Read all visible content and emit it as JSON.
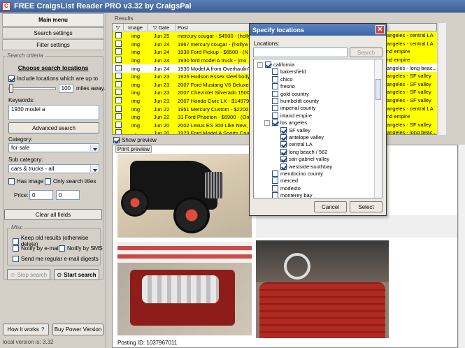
{
  "window": {
    "title": "FREE CraigsList Reader PRO v3.32 by CraigsPal"
  },
  "sidebar": {
    "main_menu": "Main menu",
    "search_settings": "Search settings",
    "filter_settings": "Filter settings",
    "search_criteria_label": "Search criteria",
    "choose_locations": "Choose search locations",
    "include_locations_label": "Include locations which are up to",
    "distance_value": "100",
    "miles_away": "miles away.",
    "keywords_label": "Keywords:",
    "keywords_value": "1930 model a",
    "advanced_search": "Advanced search",
    "category_label": "Category:",
    "category_value": "for sale",
    "subcategory_label": "Sub category:",
    "subcategory_value": "cars & trucks - all",
    "has_image": "Has image",
    "only_search_titles": "Only search titles",
    "price_label": "Price:",
    "price_min": "0",
    "price_max": "0",
    "clear_all_fields": "Clear all fields",
    "misc_label": "Misc",
    "keep_old_results": "Keep old results (otherwise delete)",
    "notify_email": "Notify by e-mail",
    "notify_sms": "Notify by SMS",
    "send_digests": "Send me regular e-mail digests",
    "stop_search": "Stop search",
    "start_search": "Start search",
    "how_it_works": "How it works",
    "buy_power": "Buy Power Version",
    "local_version": "local version is: 3.32"
  },
  "results": {
    "label": "Results",
    "columns": [
      "",
      "Image",
      "Date",
      "Post"
    ],
    "rows": [
      {
        "image": "img",
        "date": "Jun 25",
        "post": "mercury cougar - $4500 - (holly",
        "location": "angeles - central LA",
        "highlight": true
      },
      {
        "image": "img",
        "date": "Jun 24",
        "post": "1967 mercury cougar - (hollyw",
        "location": "angeles - central LA",
        "highlight": true
      },
      {
        "image": "img",
        "date": "Jun 24",
        "post": "1930 Ford Pickup - $6500 - (N",
        "location": "nd empire",
        "highlight": true
      },
      {
        "image": "img",
        "date": "Jun 24",
        "post": "1930 ford model A truck - (mo",
        "location": "nd empire",
        "highlight": true
      },
      {
        "image": "img",
        "date": "Jun 24",
        "post": "1930 Model A from Overhaulin'",
        "location": "angeles - long beac...",
        "highlight": false
      },
      {
        "image": "img",
        "date": "Jun 23",
        "post": "1926 Hudson Essex steel body",
        "location": "angeles - SF valley",
        "highlight": true
      },
      {
        "image": "img",
        "date": "Jun 23",
        "post": "2007 Ford Mustang V6 Deluxe",
        "location": "angeles - SF valley",
        "highlight": true
      },
      {
        "image": "img",
        "date": "Jun 23",
        "post": "2007 Chevrolet Silverado 1500",
        "location": "angeles - SF valley",
        "highlight": true
      },
      {
        "image": "img",
        "date": "Jun 23",
        "post": "2007 Honda Civic LX - $14979",
        "location": "angeles - SF valley",
        "highlight": true
      },
      {
        "image": "img",
        "date": "Jun 22",
        "post": "1951 Mercury Custom - $2200",
        "location": "angeles - central LA",
        "highlight": true
      },
      {
        "image": "img",
        "date": "Jun 22",
        "post": "31 Ford Phaeton - $6900 - (Ont",
        "location": "nd empire",
        "highlight": true
      },
      {
        "image": "img",
        "date": "Jun 20",
        "post": "2002 Lexus ES 300 Like New,",
        "location": "angeles - SF valley",
        "highlight": true
      },
      {
        "image": "-",
        "date": "Jun 20",
        "post": "1929 Ford Model A Sports Cou",
        "location": "angeles - long beac...",
        "highlight": true
      }
    ]
  },
  "preview": {
    "show_preview": "Show preview",
    "print_preview": "Print preview",
    "posting_id_text": "Posting ID: 1037967011"
  },
  "dialog": {
    "title": "Specify locations",
    "locations_label": "Locations:",
    "search_placeholder": "",
    "search_button": "Search",
    "tree": [
      {
        "label": "california",
        "level": 0,
        "checked": true,
        "expander": "-"
      },
      {
        "label": "bakersfield",
        "level": 1,
        "checked": false
      },
      {
        "label": "chico",
        "level": 1,
        "checked": false
      },
      {
        "label": "fresno",
        "level": 1,
        "checked": false
      },
      {
        "label": "gold country",
        "level": 1,
        "checked": false
      },
      {
        "label": "humboldt county",
        "level": 1,
        "checked": false
      },
      {
        "label": "imperial county",
        "level": 1,
        "checked": false
      },
      {
        "label": "inland empire",
        "level": 1,
        "checked": false
      },
      {
        "label": "los angeles",
        "level": 1,
        "checked": true,
        "expander": "-"
      },
      {
        "label": "SF valley",
        "level": 2,
        "checked": true
      },
      {
        "label": "antelope valley",
        "level": 2,
        "checked": true
      },
      {
        "label": "central LA",
        "level": 2,
        "checked": true
      },
      {
        "label": "long beach / 562",
        "level": 2,
        "checked": true
      },
      {
        "label": "san gabriel valley",
        "level": 2,
        "checked": true
      },
      {
        "label": "westside-southbay",
        "level": 2,
        "checked": true
      },
      {
        "label": "mendocino county",
        "level": 1,
        "checked": false
      },
      {
        "label": "merced",
        "level": 1,
        "checked": false
      },
      {
        "label": "modesto",
        "level": 1,
        "checked": false
      },
      {
        "label": "monterey bay",
        "level": 1,
        "checked": false
      }
    ],
    "cancel": "Cancel",
    "select": "Select"
  },
  "colors": {
    "highlight": "#ffff00",
    "titlebar": "#3d5f92",
    "dialog_close": "#c9453a"
  }
}
